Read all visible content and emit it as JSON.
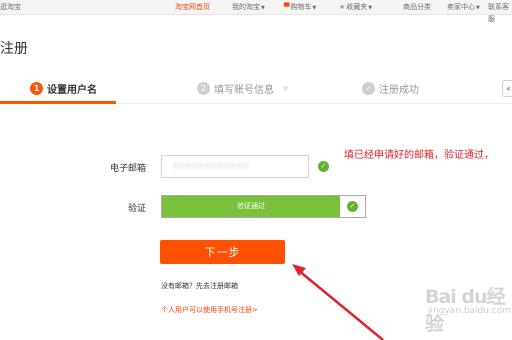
{
  "topbar": {
    "left": "逛淘宝",
    "home": "淘宝网首页",
    "my_taobao": "我的淘宝",
    "cart": "购物车",
    "favorites": "收藏夹",
    "categories": "商品分类",
    "seller_center": "卖家中心",
    "service": "联系客服"
  },
  "page_title": "注册",
  "steps": [
    {
      "num": "1",
      "label": "设置用户名"
    },
    {
      "num": "2",
      "label": "填写账号信息"
    },
    {
      "num": "✓",
      "label": "注册成功"
    }
  ],
  "form": {
    "email_label": "电子邮箱",
    "email_value": "xxxxxxxxxxxx",
    "verify_label": "验证",
    "verify_text": "验证通过",
    "next_button": "下一步",
    "no_email_text": "没有邮箱？先去注册邮箱",
    "phone_link": "个人用户可以使用手机号注册>"
  },
  "annotation": "填已经申请好的邮箱，验证通过，",
  "watermark": {
    "main": "Bai du经验",
    "sub": "jingyan.baidu.com"
  },
  "colors": {
    "accent": "#ff5400",
    "success": "#7ac23c",
    "annotation": "#e0232b"
  }
}
